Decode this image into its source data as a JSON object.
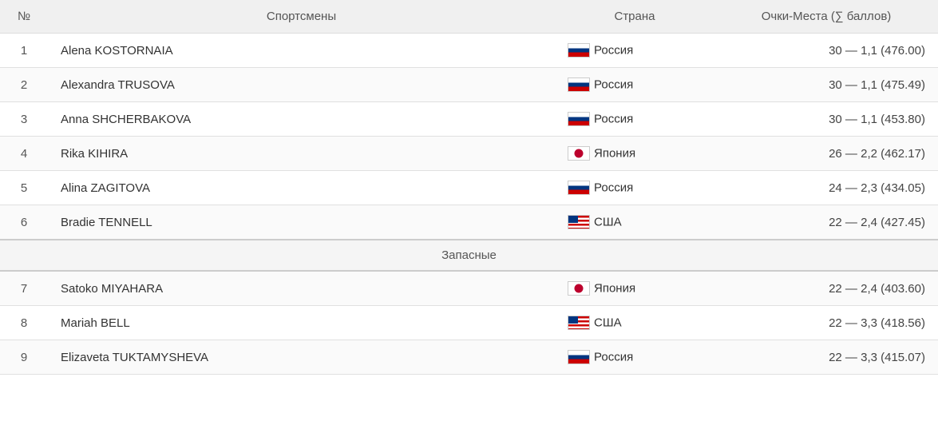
{
  "header": {
    "col_num": "№",
    "col_athletes": "Спортсмены",
    "col_country": "Страна",
    "col_score": "Очки-Места (∑ баллов)"
  },
  "separator": {
    "label": "Запасные"
  },
  "rows": [
    {
      "rank": 1,
      "name": "Alena KOSTORNAIA",
      "country": "Россия",
      "flag": "ru",
      "score": "30 — 1,1 (476.00)"
    },
    {
      "rank": 2,
      "name": "Alexandra TRUSOVA",
      "country": "Россия",
      "flag": "ru",
      "score": "30 — 1,1 (475.49)"
    },
    {
      "rank": 3,
      "name": "Anna SHCHERBAKOVA",
      "country": "Россия",
      "flag": "ru",
      "score": "30 — 1,1 (453.80)"
    },
    {
      "rank": 4,
      "name": "Rika KIHIRA",
      "country": "Япония",
      "flag": "jp",
      "score": "26 — 2,2 (462.17)"
    },
    {
      "rank": 5,
      "name": "Alina ZAGITOVA",
      "country": "Россия",
      "flag": "ru",
      "score": "24 — 2,3 (434.05)"
    },
    {
      "rank": 6,
      "name": "Bradie TENNELL",
      "country": "США",
      "flag": "us",
      "score": "22 — 2,4 (427.45)"
    }
  ],
  "reserve_rows": [
    {
      "rank": 7,
      "name": "Satoko MIYAHARA",
      "country": "Япония",
      "flag": "jp",
      "score": "22 — 2,4 (403.60)"
    },
    {
      "rank": 8,
      "name": "Mariah BELL",
      "country": "США",
      "flag": "us",
      "score": "22 — 3,3 (418.56)"
    },
    {
      "rank": 9,
      "name": "Elizaveta TUKTAMYSHEVA",
      "country": "Россия",
      "flag": "ru",
      "score": "22 — 3,3 (415.07)"
    }
  ]
}
